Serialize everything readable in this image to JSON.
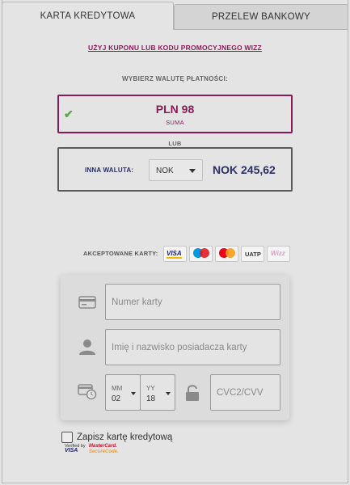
{
  "tabs": {
    "credit_card": "KARTA KREDYTOWA",
    "bank_transfer": "PRZELEW BANKOWY"
  },
  "coupon_link": "UŻYJ KUPONU LUB KODU PROMOCYJNEGO WIZZ",
  "choose_currency": "WYBIERZ WALUTĘ PŁATNOŚCI:",
  "pln_option": {
    "amount": "PLN 98",
    "subtitle": "SUMA"
  },
  "or_label": "LUB",
  "other_currency": {
    "label": "INNA WALUTA:",
    "selected": "NOK",
    "amount": "NOK 245,62"
  },
  "accepted_cards": {
    "label": "AKCEPTOWANE KARTY:",
    "visa": "VISA",
    "uatp": "UATP",
    "wizz": "Wizz"
  },
  "form": {
    "card_number_placeholder": "Numer karty",
    "cardholder_placeholder": "Imię i nazwisko posiadacza karty",
    "month_label": "MM",
    "month_value": "02",
    "year_label": "YY",
    "year_value": "18",
    "cvc_placeholder": "CVC2/CVV"
  },
  "save_card": "Zapisz kartę kredytową",
  "security_badges": {
    "vbv_top": "Verified by",
    "vbv_bottom": "VISA",
    "mc_top": "MasterCard.",
    "mc_bottom": "SecureCode."
  },
  "colors": {
    "accent": "#8a1a57",
    "navy": "#2b2f63",
    "check": "#5aa64a"
  }
}
